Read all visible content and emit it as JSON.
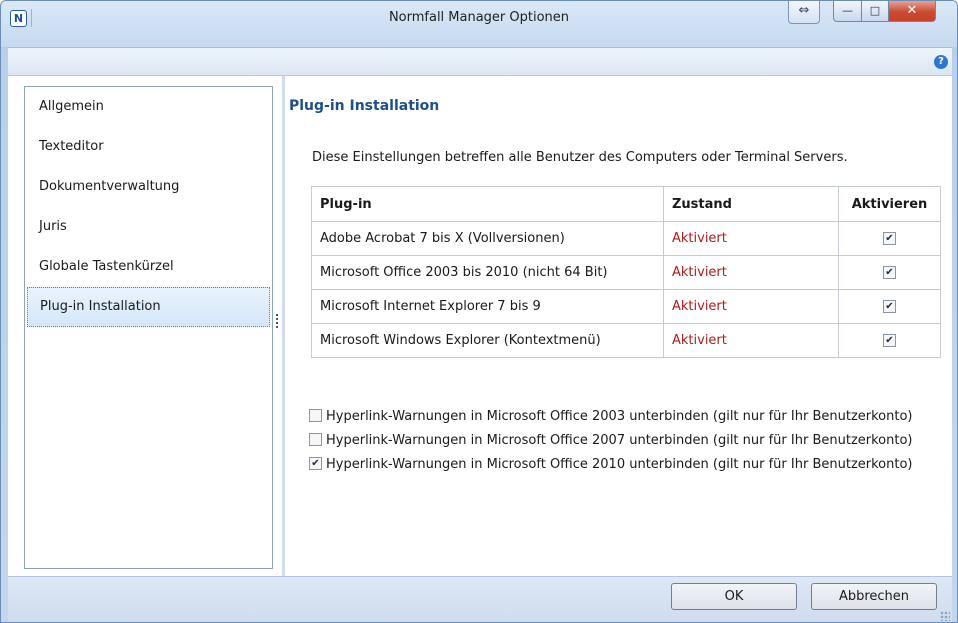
{
  "window": {
    "title": "Normfall Manager Optionen",
    "app_icon_letter": "N",
    "resize_symbol": "⇔",
    "minimize_symbol": "—",
    "maximize_symbol": "□",
    "close_symbol": "✕"
  },
  "toolbar": {
    "help_symbol": "?"
  },
  "sidebar": {
    "items": [
      {
        "label": "Allgemein",
        "selected": false
      },
      {
        "label": "Texteditor",
        "selected": false
      },
      {
        "label": "Dokumentverwaltung",
        "selected": false
      },
      {
        "label": "Juris",
        "selected": false
      },
      {
        "label": "Globale Tastenkürzel",
        "selected": false
      },
      {
        "label": "Plug-in Installation",
        "selected": true
      }
    ]
  },
  "panel": {
    "title": "Plug-in Installation",
    "description": "Diese Einstellungen betreffen alle Benutzer des Computers oder Terminal Servers.",
    "table": {
      "headers": [
        "Plug-in",
        "Zustand",
        "Aktivieren"
      ],
      "rows": [
        {
          "plugin": "Adobe Acrobat 7 bis X (Vollversionen)",
          "state": "Aktiviert",
          "checked": true
        },
        {
          "plugin": "Microsoft Office 2003 bis 2010 (nicht 64 Bit)",
          "state": "Aktiviert",
          "checked": true
        },
        {
          "plugin": "Microsoft Internet Explorer 7 bis 9",
          "state": "Aktiviert",
          "checked": true
        },
        {
          "plugin": "Microsoft Windows Explorer (Kontextmenü)",
          "state": "Aktiviert",
          "checked": true
        }
      ]
    },
    "options": [
      {
        "label": "Hyperlink-Warnungen in Microsoft Office 2003 unterbinden (gilt nur für Ihr Benutzerkonto)",
        "checked": false
      },
      {
        "label": "Hyperlink-Warnungen in Microsoft Office 2007 unterbinden (gilt nur für Ihr Benutzerkonto)",
        "checked": false
      },
      {
        "label": "Hyperlink-Warnungen in Microsoft Office 2010 unterbinden (gilt nur für Ihr Benutzerkonto)",
        "checked": true
      }
    ]
  },
  "footer": {
    "ok_label": "OK",
    "cancel_label": "Abbrechen"
  },
  "colors": {
    "state_active": "#b01b1b",
    "title_accent": "#1f4e8c",
    "selection_bg": "#d4e7f9"
  }
}
